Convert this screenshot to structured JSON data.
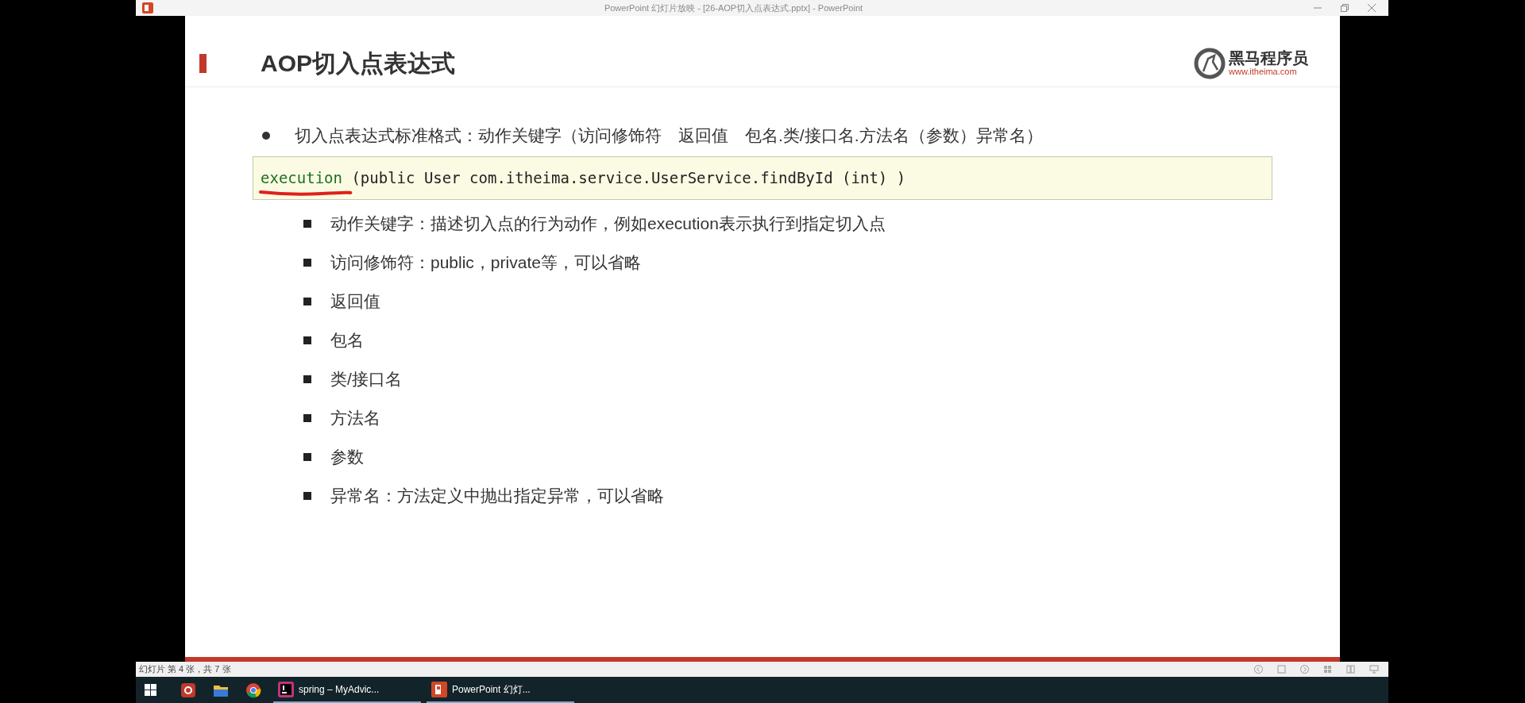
{
  "window": {
    "title": "PowerPoint 幻灯片放映 - [26-AOP切入点表达式.pptx] - PowerPoint"
  },
  "slide": {
    "title": "AOP切入点表达式",
    "logo": {
      "name": "黑马程序员",
      "url": "www.itheima.com"
    },
    "bullet": "切入点表达式标准格式：动作关键字（访问修饰符　返回值　包名.类/接口名.方法名（参数）异常名）",
    "code": {
      "keyword": "execution",
      "rest": " (public User com.itheima.service.UserService.findById (int) )"
    },
    "items": [
      "动作关键字：描述切入点的行为动作，例如execution表示执行到指定切入点",
      "访问修饰符：public，private等，可以省略",
      "返回值",
      "包名",
      "类/接口名",
      "方法名",
      "参数",
      "异常名：方法定义中抛出指定异常，可以省略"
    ]
  },
  "status_bar": {
    "text": "幻灯片 第 4 张，共 7 张"
  },
  "taskbar": {
    "windows": [
      {
        "kind": "intellij",
        "label": "spring – MyAdvic..."
      },
      {
        "kind": "powerpoint",
        "label": "PowerPoint 幻灯..."
      }
    ]
  }
}
